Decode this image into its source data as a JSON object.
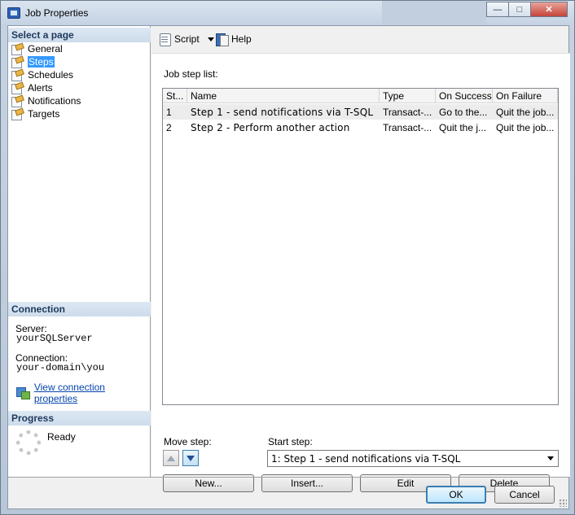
{
  "window": {
    "title": "Job Properties",
    "minimize": "—",
    "maximize": "□",
    "close": "✕"
  },
  "sidebar": {
    "select_page_header": "Select a page",
    "items": [
      {
        "label": "General"
      },
      {
        "label": "Steps",
        "selected": true
      },
      {
        "label": "Schedules"
      },
      {
        "label": "Alerts"
      },
      {
        "label": "Notifications"
      },
      {
        "label": "Targets"
      }
    ],
    "connection_header": "Connection",
    "server_label": "Server:",
    "server_value": "yourSQLServer",
    "connection_label": "Connection:",
    "connection_value": "your-domain\\you",
    "view_connection_link": "View connection properties",
    "progress_header": "Progress",
    "progress_status": "Ready"
  },
  "toolbar": {
    "script_label": "Script",
    "help_label": "Help"
  },
  "steps": {
    "list_label": "Job step list:",
    "columns": [
      "St...",
      "Name",
      "Type",
      "On Success",
      "On Failure"
    ],
    "rows": [
      [
        "1",
        "Step 1 - send notifications via T-SQL",
        "Transact-...",
        "Go to the...",
        "Quit the job..."
      ],
      [
        "2",
        "Step 2 - Perform another action",
        "Transact-...",
        "Quit the j...",
        "Quit the job..."
      ]
    ],
    "move_step_label": "Move step:",
    "start_step_label": "Start step:",
    "start_step_value": "1: Step 1 - send notifications via T-SQL",
    "new_button": "New...",
    "insert_button": "Insert...",
    "edit_button": "Edit",
    "delete_button": "Delete"
  },
  "footer": {
    "ok_button": "OK",
    "cancel_button": "Cancel"
  },
  "colors": {
    "selection": "#3399ff",
    "section_header": "#1e395b",
    "link": "#0645ad"
  }
}
